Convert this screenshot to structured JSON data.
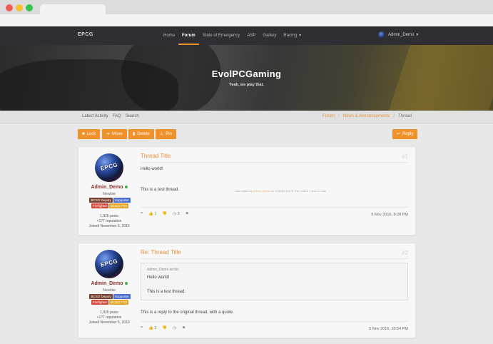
{
  "site": {
    "brand": "EPCG",
    "nav": [
      "Home",
      "Forum",
      "State of Emergency",
      "ASP",
      "Gallery",
      "Racing"
    ],
    "active_nav": "Forum",
    "user": "Admin_Demo",
    "title": "EvolPCGaming",
    "tagline": "Yeah, we play that."
  },
  "subnav": {
    "links": [
      "Latest Activity",
      "FAQ",
      "Search"
    ],
    "breadcrumbs": [
      "Forum",
      "News & Announcements",
      "Thread"
    ]
  },
  "toolbar": {
    "lock": "Lock",
    "move": "Move",
    "delete": "Delete",
    "pin": "Pin",
    "reply": "Reply"
  },
  "posts": [
    {
      "title": "Thread Title",
      "number": "#1",
      "author": "Admin_Demo",
      "rank": "Newbie",
      "badges": [
        "BCSO Deputy",
        "Supporter",
        "Firefighter",
        "BCSO FTO"
      ],
      "posts": "1,926 posts",
      "reputation": "+177 reputation",
      "joined": "Joined November 5, 2016",
      "line1": "Hello world!",
      "line2": "This is a test thread.",
      "edited_prefix": "Last edited by",
      "edited_by": "Admin_Demo",
      "edited_suffix": "on 11/6/2016 8:31 PM; edited 1 time in total",
      "likes": "1",
      "dislikes": "",
      "views": "3",
      "date": "5 Nov 2016, 8:28 PM"
    },
    {
      "title": "Re: Thread Title",
      "number": "#2",
      "author": "Admin_Demo",
      "rank": "Newbie",
      "badges": [
        "BCSO Deputy",
        "Supporter",
        "Firefighter",
        "BCSO FTO"
      ],
      "posts": "1,926 posts",
      "reputation": "+177 reputation",
      "joined": "Joined November 5, 2016",
      "quote_by": "Admin_Demo wrote:",
      "quote_line1": "Hello world!",
      "quote_line2": "This is a test thread.",
      "text": "This is a reply to the original thread, with a quote.",
      "likes": "2",
      "dislikes": "",
      "views": "",
      "date": "5 Nov 2016, 10:54 PM"
    }
  ],
  "avatar_text": "EPCG",
  "colors": {
    "accent": "#f0922b",
    "nav_bg": "#2f2f33",
    "username": "#8b2e2e"
  },
  "icons": [
    "lock-icon",
    "move-icon",
    "trash-icon",
    "pin-icon",
    "reply-icon",
    "quote-icon",
    "thumbs-up-icon",
    "thumbs-down-icon",
    "clock-icon",
    "flag-icon"
  ]
}
